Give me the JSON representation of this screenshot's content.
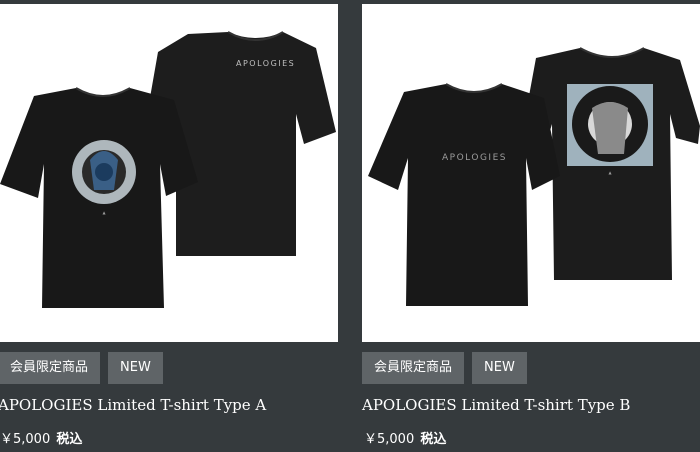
{
  "products": [
    {
      "name": "APOLOGIES Limited T-shirt Type A",
      "badges": [
        "会員限定商品",
        "NEW"
      ],
      "price": "￥5,000",
      "tax_label": "税込",
      "print_text": "APOLOGIES"
    },
    {
      "name": "APOLOGIES Limited T-shirt Type B",
      "badges": [
        "会員限定商品",
        "NEW"
      ],
      "price": "￥5,000",
      "tax_label": "税込",
      "print_text": "APOLOGIES"
    }
  ],
  "colors": {
    "background": "#353a3d",
    "badge": "#5f6467",
    "card": "#ffffff",
    "shirt": "#1b1b1b"
  }
}
